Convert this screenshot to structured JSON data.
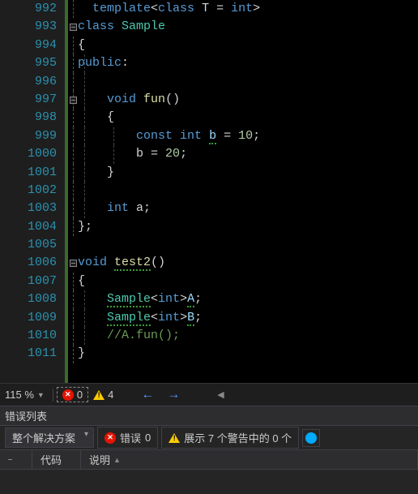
{
  "editor": {
    "lines": [
      {
        "num": "992",
        "fold": "line"
      },
      {
        "num": "993",
        "fold": "box"
      },
      {
        "num": "994",
        "fold": "line"
      },
      {
        "num": "995",
        "fold": "line"
      },
      {
        "num": "996",
        "fold": "line"
      },
      {
        "num": "997",
        "fold": "box"
      },
      {
        "num": "998",
        "fold": "line"
      },
      {
        "num": "999",
        "fold": "line"
      },
      {
        "num": "1000",
        "fold": "line"
      },
      {
        "num": "1001",
        "fold": "line"
      },
      {
        "num": "1002",
        "fold": "line"
      },
      {
        "num": "1003",
        "fold": "line"
      },
      {
        "num": "1004",
        "fold": "line"
      },
      {
        "num": "1005",
        "fold": ""
      },
      {
        "num": "1006",
        "fold": "box"
      },
      {
        "num": "1007",
        "fold": "line"
      },
      {
        "num": "1008",
        "fold": "line"
      },
      {
        "num": "1009",
        "fold": "line"
      },
      {
        "num": "1010",
        "fold": "line"
      },
      {
        "num": "1011",
        "fold": "line"
      }
    ],
    "code_tokens": {
      "l992": {
        "t1": "template",
        "t2": "<",
        "t3": "class",
        "t4": " T = ",
        "t5": "int",
        "t6": ">"
      },
      "l993": {
        "t1": "class",
        "t2": " ",
        "t3": "Sample"
      },
      "l994": {
        "t1": "{"
      },
      "l995": {
        "t1": "public",
        "t2": ":"
      },
      "l997": {
        "t1": "void",
        "t2": " ",
        "t3": "fun",
        "t4": "()"
      },
      "l998": {
        "t1": "{"
      },
      "l999": {
        "t1": "const",
        "t2": " ",
        "t3": "int",
        "t4": " ",
        "t5": "b",
        "t6": " = ",
        "t7": "10",
        "t8": ";"
      },
      "l1000": {
        "t1": "b",
        "t2": " = ",
        "t3": "20",
        "t4": ";"
      },
      "l1001": {
        "t1": "}"
      },
      "l1003": {
        "t1": "int",
        "t2": " a;"
      },
      "l1004": {
        "t1": "};"
      },
      "l1006": {
        "t1": "void",
        "t2": " ",
        "t3": "test2",
        "t4": "()"
      },
      "l1007": {
        "t1": "{"
      },
      "l1008": {
        "t1": "Sample",
        "t2": "<",
        "t3": "int",
        "t4": ">",
        "t5": "A",
        "t6": ";"
      },
      "l1009": {
        "t1": "Sample",
        "t2": "<",
        "t3": "int",
        "t4": ">",
        "t5": "B",
        "t6": ";"
      },
      "l1010": {
        "t1": "//A.fun();"
      },
      "l1011": {
        "t1": "}"
      }
    }
  },
  "status": {
    "zoom": "115 %",
    "errors": "0",
    "warnings": "4"
  },
  "panel": {
    "title": "错误列表",
    "scope": "整个解决方案",
    "errors_label": "错误",
    "errors_count": "0",
    "warnings_text": "展示 7 个警告中的 0 个",
    "col_code": "代码",
    "col_desc": "说明"
  }
}
